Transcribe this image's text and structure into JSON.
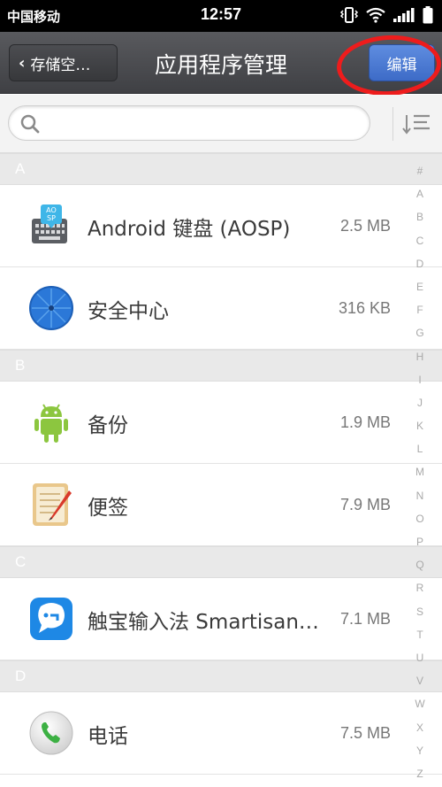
{
  "status_bar": {
    "carrier": "中国移动",
    "time": "12:57"
  },
  "header": {
    "back_label": "存储空…",
    "title": "应用程序管理",
    "edit_label": "编辑"
  },
  "search": {
    "placeholder": ""
  },
  "sections": [
    {
      "letter": "A",
      "apps": [
        {
          "name": "Android 键盘 (AOSP)",
          "size": "2.5 MB",
          "icon": "keyboard-icon"
        },
        {
          "name": "安全中心",
          "size": "316 KB",
          "icon": "security-umbrella-icon"
        }
      ]
    },
    {
      "letter": "B",
      "apps": [
        {
          "name": "备份",
          "size": "1.9 MB",
          "icon": "android-robot-icon"
        },
        {
          "name": "便签",
          "size": "7.9 MB",
          "icon": "notepad-icon"
        }
      ]
    },
    {
      "letter": "C",
      "apps": [
        {
          "name": "触宝输入法 Smartisan…",
          "size": "7.1 MB",
          "icon": "touchpal-icon"
        }
      ]
    },
    {
      "letter": "D",
      "apps": [
        {
          "name": "电话",
          "size": "7.5 MB",
          "icon": "phone-icon"
        }
      ]
    }
  ],
  "index_letters": [
    "#",
    "A",
    "B",
    "C",
    "D",
    "E",
    "F",
    "G",
    "H",
    "I",
    "J",
    "K",
    "L",
    "M",
    "N",
    "O",
    "P",
    "Q",
    "R",
    "S",
    "T",
    "U",
    "V",
    "W",
    "X",
    "Y",
    "Z"
  ],
  "colors": {
    "edit_button": "#4a78d4",
    "highlight": "#ee1c1c",
    "section_header": "#e9e9e9"
  }
}
